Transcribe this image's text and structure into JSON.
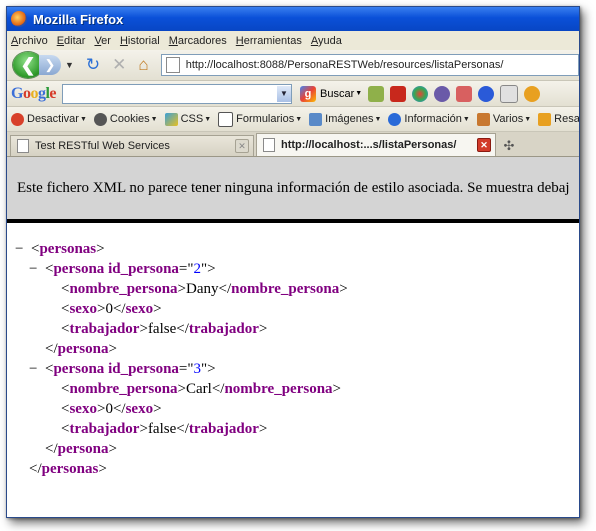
{
  "window": {
    "title": "Mozilla Firefox"
  },
  "menu": [
    "Archivo",
    "Editar",
    "Ver",
    "Historial",
    "Marcadores",
    "Herramientas",
    "Ayuda"
  ],
  "nav": {
    "url": "http://localhost:8088/PersonaRESTWeb/resources/listaPersonas/",
    "back_glyph": "❮",
    "forward_glyph": "❯"
  },
  "google_toolbar": {
    "logo": "Google",
    "search_button": "Buscar",
    "search_value": ""
  },
  "dev_toolbar": {
    "items": [
      "Desactivar",
      "Cookies",
      "CSS",
      "Formularios",
      "Imágenes",
      "Información",
      "Varios",
      "Resa"
    ]
  },
  "tabs": [
    {
      "label": "Test RESTful Web Services",
      "active": false
    },
    {
      "label": "http://localhost:...s/listaPersonas/",
      "active": true
    }
  ],
  "notice": "Este fichero XML no parece tener ninguna información de estilo asociada. Se muestra debaj",
  "xml": {
    "collapse": "−",
    "root_tag": "personas",
    "attr_name": "id_persona",
    "persons": [
      {
        "id": "2",
        "nombre": "Dany",
        "sexo": "0",
        "trabajador": "false"
      },
      {
        "id": "3",
        "nombre": "Carl",
        "sexo": "0",
        "trabajador": "false"
      }
    ],
    "tag_persona": "persona",
    "tag_nombre": "nombre_persona",
    "tag_sexo": "sexo",
    "tag_trabajador": "trabajador"
  },
  "colors": {
    "tag": "#800080",
    "attr_value": "#0000ff",
    "titlebar": "#0a50d8"
  }
}
